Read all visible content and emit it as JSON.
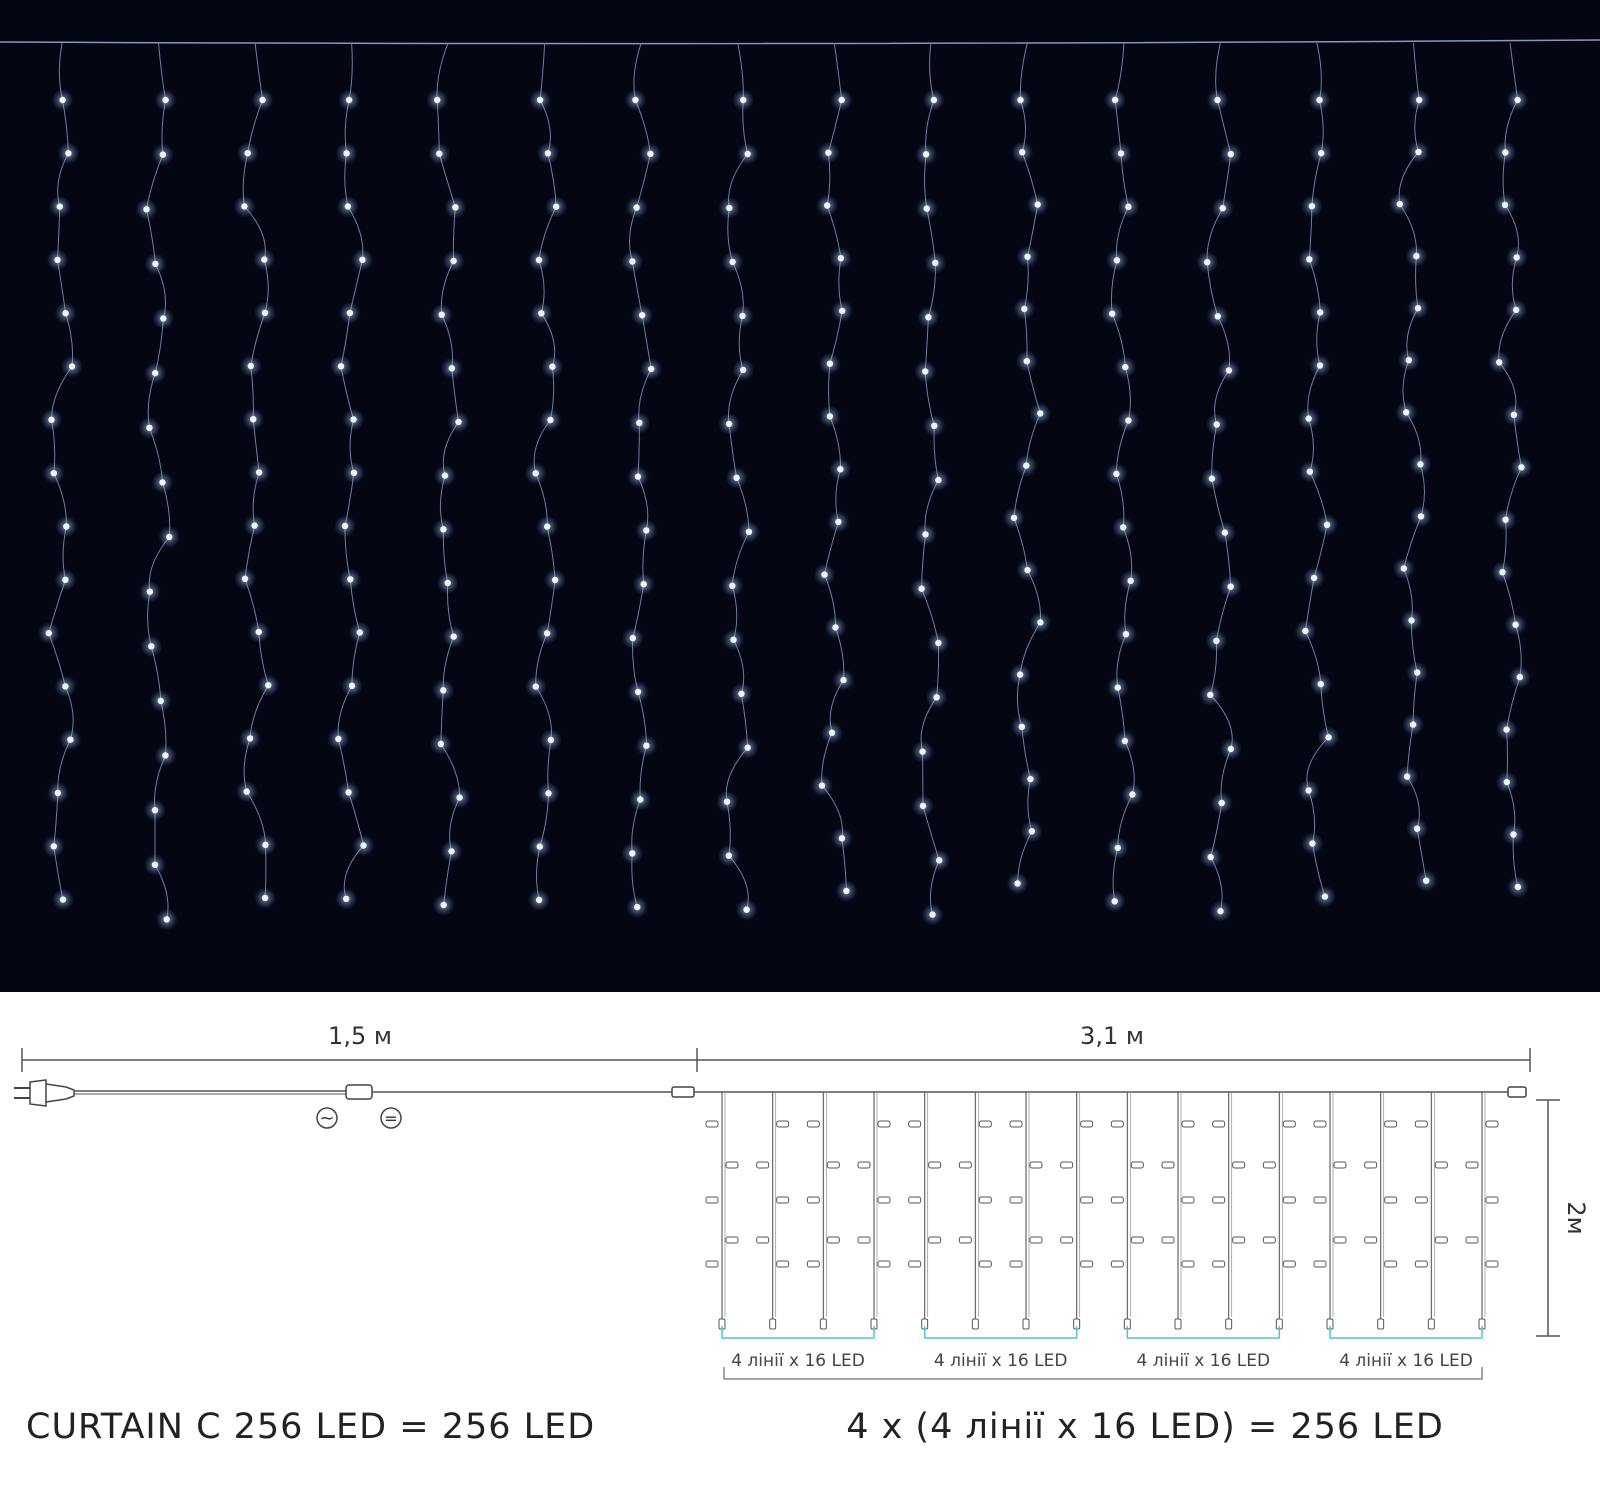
{
  "photo": {
    "background_color": "#050614",
    "led_color": "#eef5ff",
    "glow_color": "#9fc6ff",
    "strand_count": 16,
    "leds_per_strand": 16
  },
  "diagram": {
    "power_cord_length_label": "1,5 м",
    "curtain_width_label": "3,1 м",
    "curtain_height_label": "2м",
    "ac_symbol": "~",
    "dc_symbol": "=",
    "group_label": "4 лінії x 16 LED",
    "group_count": 4,
    "lines_per_group": 4,
    "bracket_color": "#4fc3e0",
    "product_formula": "CURTAIN C 256 LED = 256 LED",
    "groups_formula": "4 x (4 лінії x 16 LED) = 256 LED"
  }
}
